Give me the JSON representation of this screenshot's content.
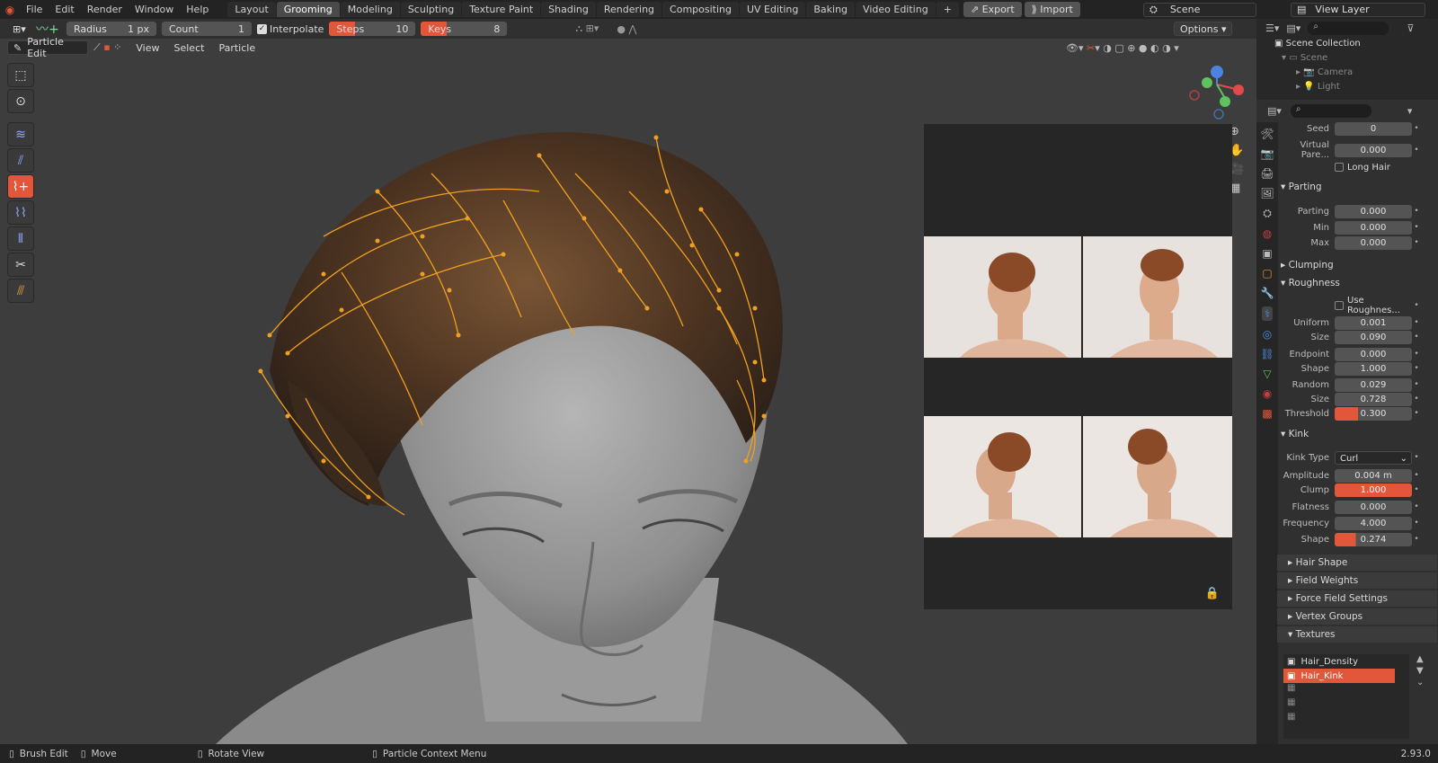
{
  "topbar": {
    "menus": [
      "File",
      "Edit",
      "Render",
      "Window",
      "Help"
    ],
    "workspaces": [
      {
        "label": "Layout",
        "active": false
      },
      {
        "label": "Grooming",
        "active": true
      },
      {
        "label": "Modeling",
        "active": false
      },
      {
        "label": "Sculpting",
        "active": false
      },
      {
        "label": "Texture Paint",
        "active": false
      },
      {
        "label": "Shading",
        "active": false
      },
      {
        "label": "Rendering",
        "active": false
      },
      {
        "label": "Compositing",
        "active": false
      },
      {
        "label": "UV Editing",
        "active": false
      },
      {
        "label": "Baking",
        "active": false
      },
      {
        "label": "Video Editing",
        "active": false
      }
    ],
    "add_tab": "+",
    "export_label": "Export",
    "import_label": "Import",
    "scene": "Scene",
    "view_layer": "View Layer"
  },
  "tool_header": {
    "radius_label": "Radius",
    "radius_value": "1 px",
    "count_label": "Count",
    "count_value": "1",
    "interpolate_label": "Interpolate",
    "steps_label": "Steps",
    "steps_value": "10",
    "keys_label": "Keys",
    "keys_value": "8",
    "options_label": "Options"
  },
  "viewport_header": {
    "mode": "Particle Edit",
    "menus": [
      "View",
      "Select",
      "Particle"
    ]
  },
  "outliner": {
    "title": "Scene Collection",
    "items": [
      "Scene",
      "Camera",
      "Light"
    ]
  },
  "properties": {
    "seed_label": "Seed",
    "seed_value": "0",
    "virtual_parents_label": "Virtual Pare...",
    "virtual_parents_value": "0.000",
    "long_hair_label": "Long Hair",
    "parting_section": "Parting",
    "parting_label": "Parting",
    "parting_value": "0.000",
    "min_label": "Min",
    "min_value": "0.000",
    "max_label": "Max",
    "max_value": "0.000",
    "clumping_section": "Clumping",
    "roughness_section": "Roughness",
    "use_roughness_label": "Use Roughnes...",
    "uniform_label": "Uniform",
    "uniform_value": "0.001",
    "size1_label": "Size",
    "size1_value": "0.090",
    "endpoint_label": "Endpoint",
    "endpoint_value": "0.000",
    "shape1_label": "Shape",
    "shape1_value": "1.000",
    "random_label": "Random",
    "random_value": "0.029",
    "size2_label": "Size",
    "size2_value": "0.728",
    "threshold_label": "Threshold",
    "threshold_value": "0.300",
    "threshold_fill": 0.3,
    "kink_section": "Kink",
    "kink_type_label": "Kink Type",
    "kink_type_value": "Curl",
    "amplitude_label": "Amplitude",
    "amplitude_value": "0.004 m",
    "clump_label": "Clump",
    "clump_value": "1.000",
    "flatness_label": "Flatness",
    "flatness_value": "0.000",
    "frequency_label": "Frequency",
    "frequency_value": "4.000",
    "shape2_label": "Shape",
    "shape2_value": "0.274",
    "shape2_fill": 0.274,
    "panels": [
      "Hair Shape",
      "Field Weights",
      "Force Field Settings",
      "Vertex Groups",
      "Textures"
    ],
    "textures": [
      "Hair_Density",
      "Hair_Kink"
    ]
  },
  "statusbar": {
    "brush_edit": "Brush Edit",
    "move": "Move",
    "rotate_view": "Rotate View",
    "context_menu": "Particle Context Menu",
    "version": "2.93.0"
  },
  "colors": {
    "accent": "#e2573a",
    "hair_guides": "#f0a020"
  }
}
